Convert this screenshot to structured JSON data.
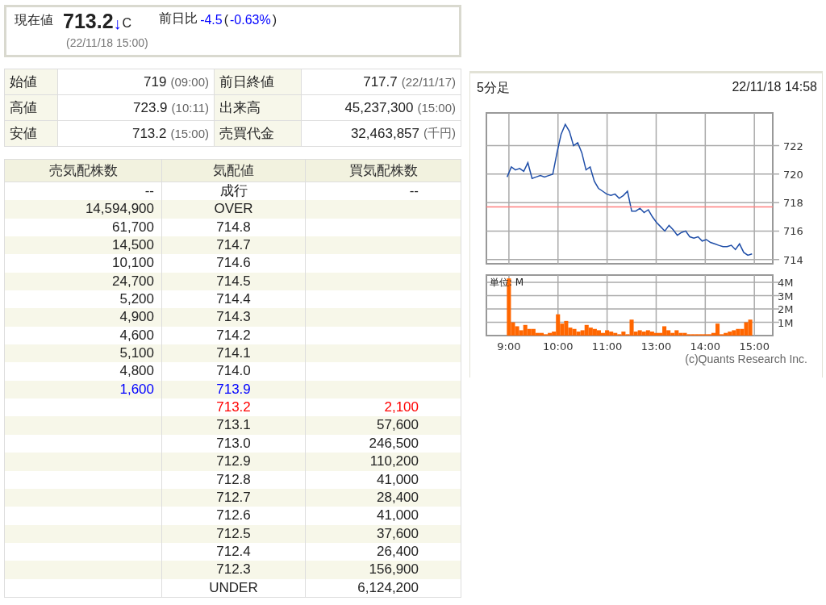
{
  "quote": {
    "label": "現在値",
    "price": "713.2",
    "arrow": "↓",
    "mark": "C",
    "time": "(22/11/18 15:00)",
    "change_label": "前日比",
    "change": "-4.5",
    "paren_open": "(",
    "change_pct": "-0.63%",
    "paren_close": ")"
  },
  "stats": [
    {
      "label": "始値",
      "value": "719",
      "note": "(09:00)"
    },
    {
      "label": "前日終値",
      "value": "717.7",
      "note": "(22/11/17)"
    },
    {
      "label": "高値",
      "value": "723.9",
      "note": "(10:11)"
    },
    {
      "label": "出来高",
      "value": "45,237,300",
      "note": "(15:00)"
    },
    {
      "label": "安値",
      "value": "713.2",
      "note": "(15:00)"
    },
    {
      "label": "売買代金",
      "value": "32,463,857",
      "note": "(千円)"
    }
  ],
  "order_book": {
    "columns": [
      "売気配株数",
      "気配値",
      "買気配株数"
    ],
    "rows": [
      {
        "sell": "--",
        "price": "成行",
        "buy": "--"
      },
      {
        "sell": "14,594,900",
        "price": "OVER"
      },
      {
        "sell": "61,700",
        "price": "714.8"
      },
      {
        "sell": "14,500",
        "price": "714.7"
      },
      {
        "sell": "10,100",
        "price": "714.6"
      },
      {
        "sell": "24,700",
        "price": "714.5"
      },
      {
        "sell": "5,200",
        "price": "714.4"
      },
      {
        "sell": "4,900",
        "price": "714.3"
      },
      {
        "sell": "4,600",
        "price": "714.2"
      },
      {
        "sell": "5,100",
        "price": "714.1"
      },
      {
        "sell": "4,800",
        "price": "714.0"
      },
      {
        "sell": "1,600",
        "price": "713.9",
        "color": "#0000ff"
      },
      {
        "price": "713.2",
        "buy": "2,100",
        "color": "#ff0000"
      },
      {
        "price": "713.1",
        "buy": "57,600"
      },
      {
        "price": "713.0",
        "buy": "246,500"
      },
      {
        "price": "712.9",
        "buy": "110,200"
      },
      {
        "price": "712.8",
        "buy": "41,000"
      },
      {
        "price": "712.7",
        "buy": "28,400"
      },
      {
        "price": "712.6",
        "buy": "41,000"
      },
      {
        "price": "712.5",
        "buy": "37,600"
      },
      {
        "price": "712.4",
        "buy": "26,400"
      },
      {
        "price": "712.3",
        "buy": "156,900"
      },
      {
        "price": "UNDER",
        "buy": "6,124,200"
      }
    ]
  },
  "chart_panel": {
    "title": "5分足",
    "time": "22/11/18 14:58",
    "copyright": "(c)Quants Research Inc.",
    "price_chart": {
      "chart_data": {
        "type": "line",
        "grid": true,
        "ylim": [
          713.7,
          724.3
        ],
        "yticks": [
          714,
          716,
          718,
          720,
          722
        ],
        "series": [
          {
            "color": "#1f4ea8",
            "values": [
              null,
              null,
              null,
              null,
              null,
              719.8,
              720.5,
              720.3,
              720.4,
              720.2,
              720.8,
              719.7,
              719.8,
              719.9,
              719.8,
              719.9,
              720.0,
              721.5,
              722.8,
              723.5,
              723.0,
              722.0,
              722.2,
              721.5,
              720.3,
              720.5,
              719.5,
              719.0,
              718.8,
              718.6,
              718.5,
              718.6,
              718.3,
              718.5,
              718.8,
              717.4,
              717.4,
              717.6,
              717.3,
              717.5,
              717.0,
              716.6,
              716.3,
              716.0,
              716.4,
              716.1,
              715.7,
              715.9,
              716.0,
              715.6,
              715.5,
              715.6,
              715.3,
              715.4,
              715.2,
              715.1,
              715.0,
              714.9,
              714.9,
              715.0,
              714.7,
              715.1,
              714.5,
              714.3,
              714.4,
              null,
              null,
              null,
              null,
              null
            ]
          },
          {
            "color": "#ff8080",
            "values": [
              717.7,
              717.7,
              717.7,
              717.7,
              717.7,
              717.7,
              717.7,
              717.7,
              717.7,
              717.7,
              717.7,
              717.7,
              717.7,
              717.7,
              717.7,
              717.7,
              717.7,
              717.7,
              717.7,
              717.7,
              717.7,
              717.7,
              717.7,
              717.7,
              717.7,
              717.7,
              717.7,
              717.7,
              717.7,
              717.7,
              717.7,
              717.7,
              717.7,
              717.7,
              717.7,
              717.7,
              717.7,
              717.7,
              717.7,
              717.7,
              717.7,
              717.7,
              717.7,
              717.7,
              717.7,
              717.7,
              717.7,
              717.7,
              717.7,
              717.7,
              717.7,
              717.7,
              717.7,
              717.7,
              717.7,
              717.7,
              717.7,
              717.7,
              717.7,
              717.7,
              717.7,
              717.7,
              717.7,
              717.7,
              717.7,
              717.7,
              717.7,
              717.7,
              717.7,
              717.7
            ]
          }
        ]
      }
    },
    "volume_chart": {
      "chart_data": {
        "type": "bar",
        "grid": true,
        "ylabel": "単位: M",
        "ylim": [
          0,
          4.55
        ],
        "categories": [
          null,
          null,
          null,
          null,
          null,
          "9:00",
          null,
          null,
          null,
          null,
          null,
          null,
          null,
          null,
          null,
          null,
          null,
          "10:00",
          null,
          null,
          null,
          null,
          null,
          null,
          null,
          null,
          null,
          null,
          null,
          "11:00",
          null,
          null,
          null,
          null,
          null,
          null,
          null,
          null,
          null,
          null,
          null,
          "13:00",
          null,
          null,
          null,
          null,
          null,
          null,
          null,
          null,
          null,
          null,
          null,
          "14:00",
          null,
          null,
          null,
          null,
          null,
          null,
          null,
          null,
          null,
          null,
          null,
          "15:00",
          null,
          null,
          null,
          null
        ],
        "yticks": [
          {
            "value": 1,
            "label": "1M"
          },
          {
            "value": 2,
            "label": "2M"
          },
          {
            "value": 3,
            "label": "3M"
          },
          {
            "value": 4,
            "label": "4M"
          }
        ],
        "series": [
          {
            "color": "#ff6600",
            "values": [
              null,
              null,
              null,
              null,
              null,
              4.3,
              1.0,
              0.7,
              0.4,
              0.8,
              0.5,
              0.5,
              0.2,
              0.2,
              0.1,
              0.2,
              0.3,
              1.6,
              0.9,
              1.1,
              0.6,
              0.5,
              0.3,
              0.4,
              0.8,
              0.6,
              0.5,
              0.4,
              0.2,
              0.4,
              0.3,
              0.2,
              0.1,
              0.3,
              0.1,
              1.2,
              0.3,
              0.4,
              0.3,
              0.4,
              0.3,
              0.2,
              0.2,
              0.7,
              0.4,
              0.2,
              0.4,
              0.2,
              0.2,
              0.1,
              0.1,
              0.1,
              0.1,
              0.1,
              0.1,
              0.2,
              0.9,
              0.1,
              0.2,
              0.3,
              0.4,
              0.5,
              0.5,
              1.0,
              1.2,
              null,
              null,
              null,
              null,
              null
            ]
          }
        ]
      }
    }
  }
}
